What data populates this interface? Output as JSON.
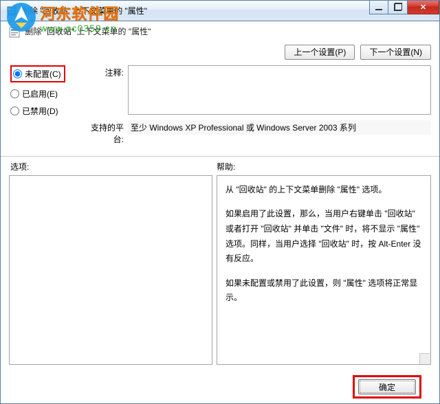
{
  "watermark": {
    "cn": "河东软件园",
    "url": "www.pc0359.cn"
  },
  "titlebar": {
    "title": "删除 \"回收站\" 上下文菜单的 \"属性\""
  },
  "subtitle": "删除 \"回收站\" 上下文菜单的 \"属性\"",
  "nav": {
    "prev": "上一个设置(P)",
    "next": "下一个设置(N)"
  },
  "radios": {
    "notconfigured": "未配置(C)",
    "enabled": "已启用(E)",
    "disabled": "已禁用(D)"
  },
  "fields": {
    "remark_label": "注释:",
    "remark_value": "",
    "platform_label": "支持的平台:",
    "platform_value": "至少 Windows XP Professional 或 Windows Server 2003 系列"
  },
  "section": {
    "options": "选项:",
    "help": "帮助:"
  },
  "help": {
    "p1": "从 \"回收站\" 的上下文菜单删除 \"属性\" 选项。",
    "p2": "如果启用了此设置，那么，当用户右键单击 \"回收站\" 或者打开 \"回收站\" 并单击 \"文件\" 时，将不显示 \"属性\" 选项。同样，当用户选择 \"回收站\" 时，按 Alt-Enter 没有反应。",
    "p3": "如果未配置或禁用了此设置，则 \"属性\" 选项将正常显示。"
  },
  "buttons": {
    "ok": "确定"
  }
}
